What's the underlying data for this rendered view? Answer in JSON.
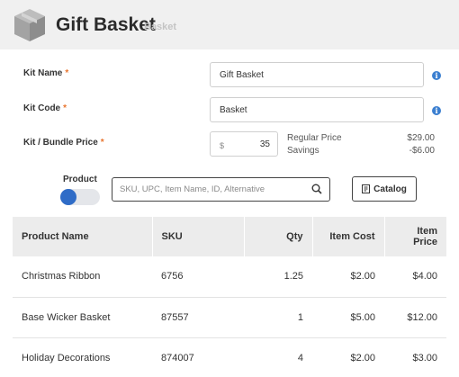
{
  "header": {
    "title": "Gift Basket",
    "subtitle": "Basket",
    "icon": "box-icon"
  },
  "form": {
    "kit_name": {
      "label": "Kit Name",
      "required_mark": "*",
      "value": "Gift Basket"
    },
    "kit_code": {
      "label": "Kit Code",
      "required_mark": "*",
      "value": "Basket"
    },
    "bundle_price": {
      "label": "Kit / Bundle Price",
      "required_mark": "*",
      "currency": "$",
      "value": "35"
    },
    "info_icon": "i"
  },
  "summary": {
    "regular_price_label": "Regular Price",
    "regular_price_value": "$29.00",
    "savings_label": "Savings",
    "savings_value": "-$6.00"
  },
  "product_toggle": {
    "label": "Product",
    "on": true,
    "color": "#2f6cc7"
  },
  "search": {
    "placeholder": "SKU, UPC, Item Name, ID, Alternative",
    "value": ""
  },
  "catalog_button": {
    "label": "Catalog",
    "icon": "catalog-icon"
  },
  "table": {
    "columns": [
      "Product Name",
      "SKU",
      "Qty",
      "Item Cost",
      "Item Price"
    ],
    "rows": [
      {
        "name": "Christmas Ribbon",
        "sku": "6756",
        "qty": "1.25",
        "cost": "$2.00",
        "price": "$4.00"
      },
      {
        "name": "Base Wicker Basket",
        "sku": "87557",
        "qty": "1",
        "cost": "$5.00",
        "price": "$12.00"
      },
      {
        "name": "Holiday Decorations",
        "sku": "874007",
        "qty": "4",
        "cost": "$2.00",
        "price": "$3.00"
      }
    ]
  },
  "colors": {
    "accent": "#2f6cc7",
    "required": "#e8742e",
    "header_bg": "#f0f0f0"
  }
}
